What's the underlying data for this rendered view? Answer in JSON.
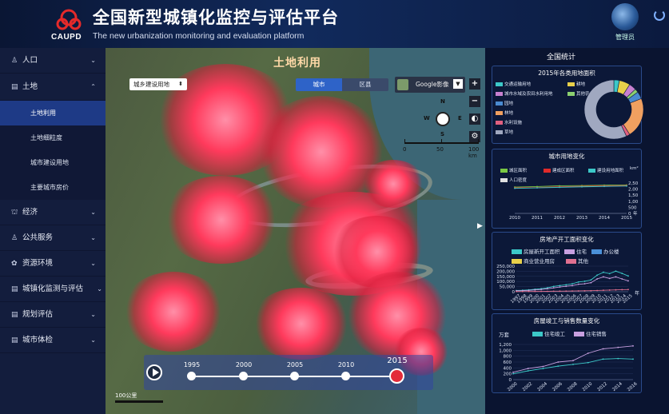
{
  "header": {
    "title_cn": "全国新型城镇化监控与评估平台",
    "title_en": "The new urbanization monitoring and evaluation platform",
    "logo_text": "CAUPD",
    "user_label": "管理员"
  },
  "sidebar": {
    "items": [
      {
        "label": "人口",
        "expanded": false
      },
      {
        "label": "土地",
        "expanded": true
      },
      {
        "label": "经济",
        "expanded": false
      },
      {
        "label": "公共服务",
        "expanded": false
      },
      {
        "label": "资源环境",
        "expanded": false
      },
      {
        "label": "城镇化监测与评估",
        "expanded": false
      },
      {
        "label": "规划评估",
        "expanded": false
      },
      {
        "label": "城市体检",
        "expanded": false
      }
    ],
    "land_subitems": [
      "土地利用",
      "土地细粒度",
      "城市建设用地",
      "主要城市房价"
    ],
    "active_subitem": "土地利用"
  },
  "map": {
    "title": "土地利用",
    "land_select": "城乡建设用地",
    "tabs": [
      "城市",
      "区县"
    ],
    "active_tab": "城市",
    "basemap": "Google影像",
    "compass": {
      "n": "N",
      "s": "S",
      "e": "E",
      "w": "W"
    },
    "scale_labels": [
      "0",
      "50",
      "100 km"
    ],
    "map_scale": "100公里",
    "timeline": {
      "years": [
        "1995",
        "2000",
        "2005",
        "2010",
        "2015"
      ],
      "active": "2015"
    }
  },
  "panel": {
    "title": "全国统计",
    "donut": {
      "title": "2015年各类用地面积",
      "legend": [
        {
          "name": "交通运输用地",
          "color": "#3cc8c8"
        },
        {
          "name": "耕地",
          "color": "#e8d04a"
        },
        {
          "name": "城市水域及农田水利用地",
          "color": "#c880d0"
        },
        {
          "name": "其他农用地",
          "color": "#8cd070"
        },
        {
          "name": "园地",
          "color": "#4a8ad0"
        },
        {
          "name": "林地",
          "color": "#f0a060"
        },
        {
          "name": "水利设施",
          "color": "#e06080"
        },
        {
          "name": "草地",
          "color": "#a0a8c0"
        }
      ]
    },
    "city_land": {
      "title": "城市用地变化",
      "legend": [
        {
          "name": "城区面积",
          "color": "#7ac843"
        },
        {
          "name": "建成区面积",
          "color": "#e02a2a"
        },
        {
          "name": "建设用地面积",
          "color": "#3cc8c8"
        },
        {
          "name": "人口密度",
          "color": "#e0e0e0"
        }
      ],
      "unit": "km²",
      "year_unit": "年"
    },
    "real_estate": {
      "title": "房地产开工面积变化",
      "legend": [
        {
          "name": "房屋新开工面积",
          "color": "#3cc8c8"
        },
        {
          "name": "住宅",
          "color": "#c8a0e0"
        },
        {
          "name": "办公楼",
          "color": "#4a90d8"
        },
        {
          "name": "商业营业用房",
          "color": "#e8d04a"
        },
        {
          "name": "其他",
          "color": "#e07090"
        }
      ],
      "year_unit": "年"
    },
    "sales": {
      "title": "房屋竣工与销售数量变化",
      "unit": "万套",
      "legend": [
        {
          "name": "住宅竣工",
          "color": "#3cc8c8"
        },
        {
          "name": "住宅销售",
          "color": "#c8a0e0"
        }
      ]
    }
  },
  "chart_data": [
    {
      "type": "pie",
      "title": "2015年各类用地面积",
      "categories": [
        "交通运输用地",
        "耕地",
        "城市水域及农田水利用地",
        "其他农用地",
        "园地",
        "林地",
        "水利设施",
        "草地"
      ],
      "values": [
        3,
        6,
        4,
        2,
        4,
        22,
        2,
        57
      ]
    },
    {
      "type": "line",
      "title": "城市用地变化",
      "x": [
        2010,
        2011,
        2012,
        2013,
        2014,
        2015
      ],
      "ylim_left": [
        0,
        60000
      ],
      "y_ticks_right": [
        "2,50",
        "2,00",
        "1,50",
        "1,00",
        "500",
        "0"
      ],
      "series": [
        {
          "name": "城区面积",
          "values": [
            52000,
            53000,
            54500,
            55000,
            55800,
            56200
          ]
        },
        {
          "name": "建成区面积",
          "values": [
            50500,
            51000,
            52500,
            53500,
            54500,
            55000
          ]
        },
        {
          "name": "建设用地面积",
          "values": [
            49500,
            50500,
            51500,
            52500,
            53300,
            54000
          ]
        }
      ]
    },
    {
      "type": "line",
      "title": "房地产开工面积变化",
      "y_ticks": [
        "250,000",
        "200,000",
        "150,000",
        "100,000",
        "50,000",
        "0"
      ],
      "x": [
        "1997",
        "1998",
        "1999",
        "2000",
        "2001",
        "2002",
        "2003",
        "2004",
        "2005",
        "2006",
        "2007",
        "2008",
        "2009",
        "2010",
        "2011",
        "2012",
        "2013",
        "2014",
        "2015"
      ],
      "series": [
        {
          "name": "房屋新开工面积",
          "values": [
            12000,
            14000,
            18000,
            24000,
            30000,
            39000,
            52000,
            60000,
            68000,
            78000,
            95000,
            102000,
            115000,
            162000,
            190000,
            177000,
            201000,
            179000,
            154000
          ]
        },
        {
          "name": "住宅",
          "values": [
            9000,
            10000,
            13000,
            18000,
            22000,
            29000,
            38000,
            46000,
            53000,
            60000,
            73000,
            78000,
            88000,
            125000,
            145000,
            130000,
            145000,
            125000,
            106000
          ]
        },
        {
          "name": "其他",
          "values": [
            2000,
            2200,
            2600,
            3000,
            3500,
            4000,
            5000,
            5500,
            6000,
            7000,
            8000,
            9000,
            10000,
            12000,
            14000,
            16000,
            18000,
            20000,
            21000
          ]
        }
      ]
    },
    {
      "type": "line",
      "title": "房屋竣工与销售数量变化",
      "y_ticks": [
        "1,200",
        "1,000",
        "800",
        "600",
        "400",
        "200",
        "0"
      ],
      "x": [
        "2000",
        "2002",
        "2004",
        "2006",
        "2008",
        "2010",
        "2012",
        "2014",
        "2016"
      ],
      "series": [
        {
          "name": "住宅竣工",
          "values": [
            200,
            300,
            380,
            460,
            520,
            580,
            700,
            720,
            700
          ]
        },
        {
          "name": "住宅销售",
          "values": [
            250,
            380,
            450,
            600,
            650,
            900,
            1050,
            1100,
            1150
          ]
        }
      ]
    }
  ]
}
